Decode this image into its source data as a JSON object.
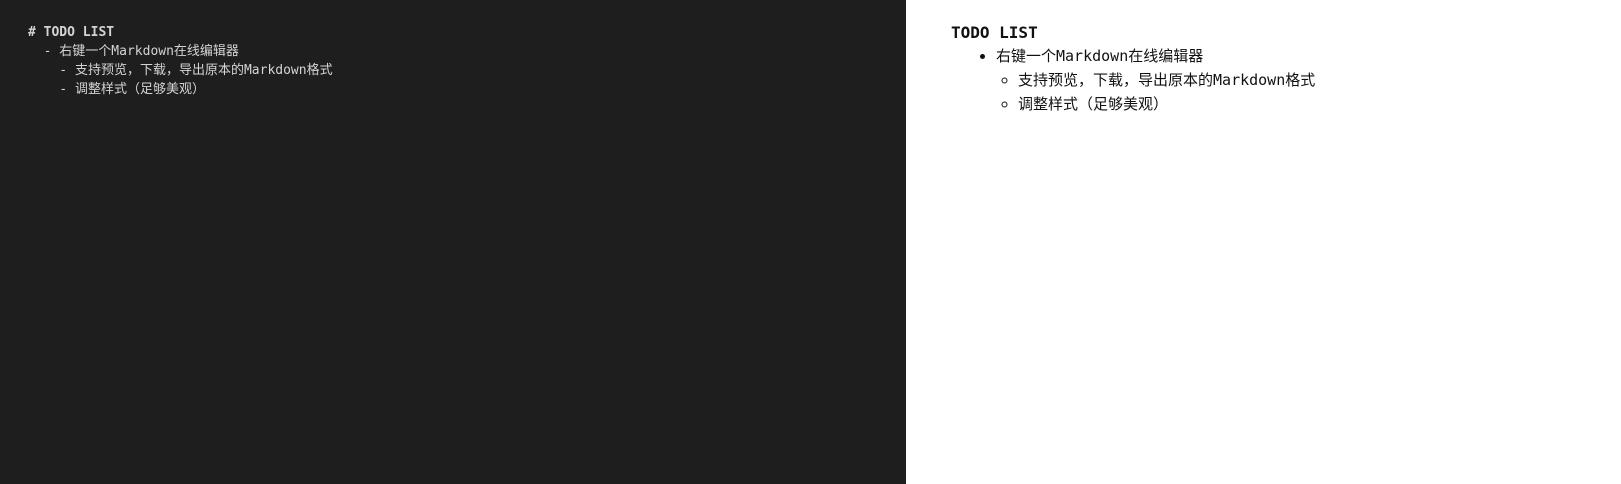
{
  "editor": {
    "lines": [
      "# TODO LIST",
      "  - 右键一个Markdown在线编辑器",
      "    - 支持预览，下载，导出原本的Markdown格式",
      "    - 调整样式（足够美观）"
    ],
    "background": "#1e1e1e",
    "text_color": "#d4d4d4"
  },
  "preview": {
    "heading": "TODO LIST",
    "items": [
      {
        "text": "右键一个Markdown在线编辑器",
        "children": [
          "支持预览，下载，导出原本的Markdown格式",
          "调整样式（足够美观）"
        ]
      }
    ],
    "background": "#ffffff",
    "text_color": "#111111"
  }
}
